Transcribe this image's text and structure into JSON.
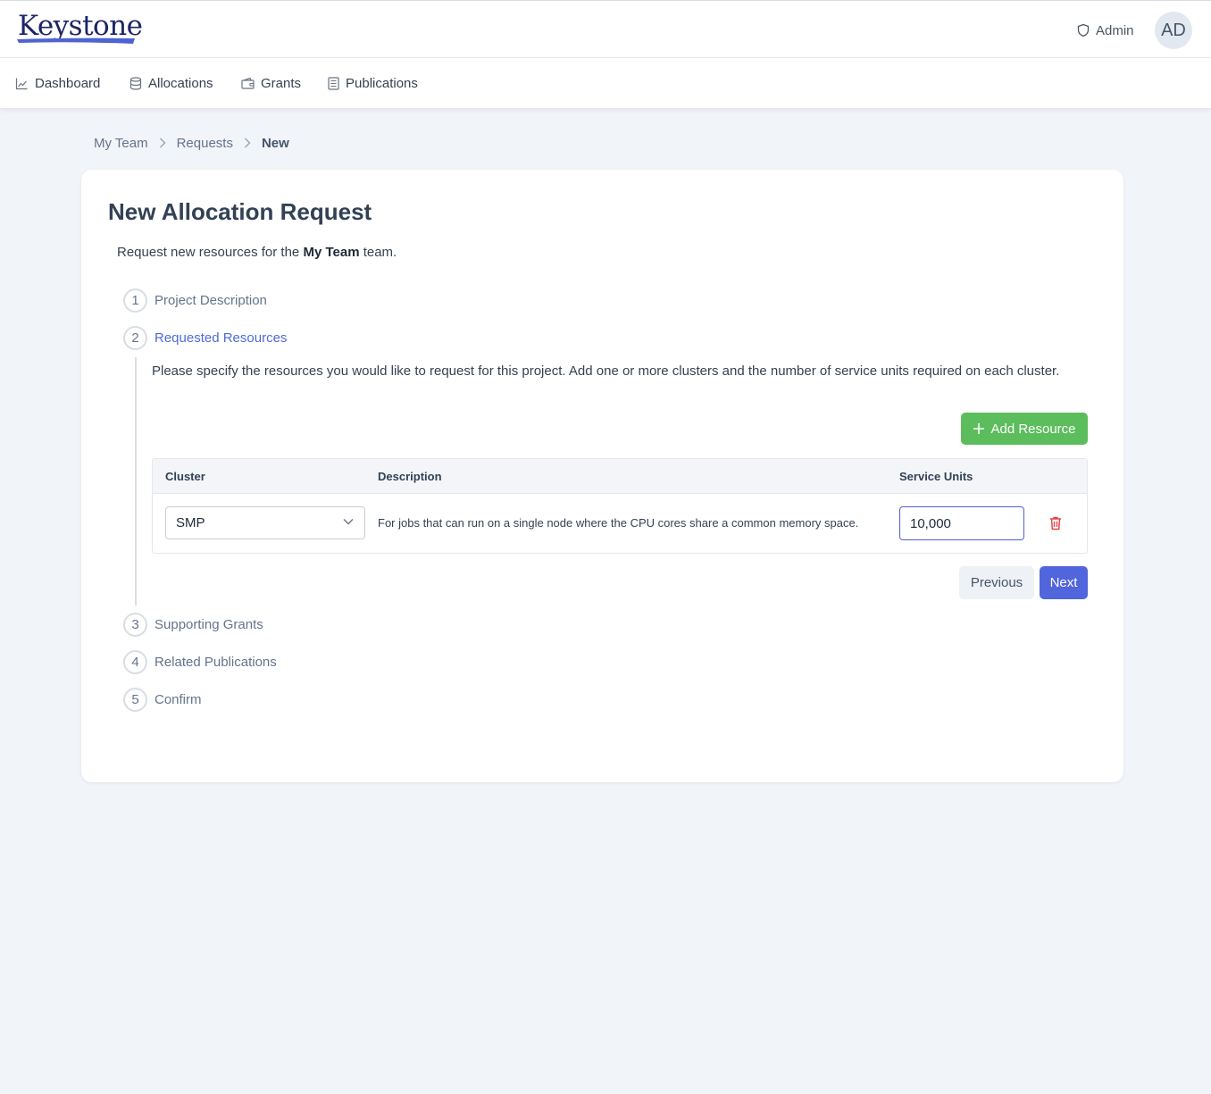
{
  "app": {
    "logo_text": "Keystone"
  },
  "header": {
    "admin_label": "Admin",
    "avatar_initials": "AD"
  },
  "nav": {
    "items": [
      {
        "label": "Dashboard",
        "icon": "chart-line-icon"
      },
      {
        "label": "Allocations",
        "icon": "database-icon"
      },
      {
        "label": "Grants",
        "icon": "wallet-icon"
      },
      {
        "label": "Publications",
        "icon": "document-icon"
      }
    ]
  },
  "breadcrumb": {
    "items": [
      "My Team",
      "Requests"
    ],
    "current": "New"
  },
  "page": {
    "title": "New Allocation Request",
    "intro_prefix": "Request new resources for the ",
    "intro_team": "My Team",
    "intro_suffix": " team."
  },
  "steps": [
    {
      "number": "1",
      "label": "Project Description"
    },
    {
      "number": "2",
      "label": "Requested Resources",
      "active": true
    },
    {
      "number": "3",
      "label": "Supporting Grants"
    },
    {
      "number": "4",
      "label": "Related Publications"
    },
    {
      "number": "5",
      "label": "Confirm"
    }
  ],
  "resources": {
    "description": "Please specify the resources you would like to request for this project. Add one or more clusters and the number of service units required on each cluster.",
    "add_button": "Add Resource",
    "columns": {
      "cluster": "Cluster",
      "description": "Description",
      "units": "Service Units"
    },
    "rows": [
      {
        "cluster": "SMP",
        "description": "For jobs that can run on a single node where the CPU cores share a common memory space.",
        "units": "10,000"
      }
    ]
  },
  "actions": {
    "previous": "Previous",
    "next": "Next"
  },
  "colors": {
    "accent": "#5165dd",
    "success": "#5cbd5c",
    "danger": "#e04848",
    "active_step": "#4f6bdb"
  }
}
